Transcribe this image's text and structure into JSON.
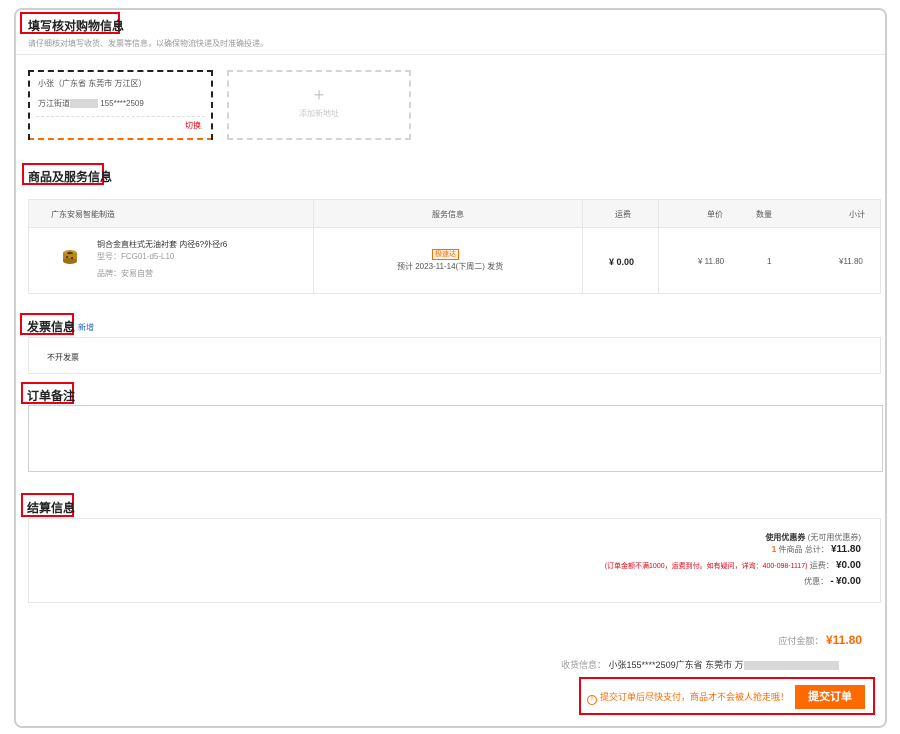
{
  "header": {
    "title": "填写核对购物信息",
    "hint": "请仔细核对填写收货、发票等信息，以确保物流快递及时准确投递。"
  },
  "address": {
    "selected": {
      "name": "小张（广东省 东莞市 万江区）",
      "street": "万江街道",
      "phone": "155****2509",
      "switch_label": "切换"
    },
    "add_label": "添加新地址",
    "add_icon": "plus-icon"
  },
  "goods": {
    "title": "商品及服务信息",
    "columns": {
      "shop": "广东安易智能制造",
      "service": "服务信息",
      "freight": "运费",
      "price": "单价",
      "qty": "数量",
      "subtotal": "小计"
    },
    "item": {
      "name": "铜合金直柱式无油衬套 内径6?外径r6",
      "model": "型号：FCG01-d5-L10",
      "brand": "品牌：安易自营",
      "tag": "极速达",
      "ship": "预计 2023-11-14(下周二) 发货",
      "freight": "¥ 0.00",
      "price": "¥ 11.80",
      "qty": "1",
      "subtotal": "¥11.80"
    }
  },
  "invoice": {
    "title": "发票信息",
    "add_link": "新增",
    "value": "不开发票"
  },
  "memo": {
    "title": "订单备注",
    "value": ""
  },
  "settlement": {
    "title": "结算信息",
    "coupon_label": "使用优惠券",
    "coupon_note": "(无可用优惠券)",
    "item_count": "1",
    "item_count_label": "件商品  总计：",
    "total": "¥11.80",
    "freight_note": "(订单金额不满1000，运费到付。如有疑问，详询：400-098-1117)",
    "freight_label": "运费：",
    "freight": "¥0.00",
    "discount_label": "优惠：",
    "discount_sign": "-",
    "discount": "¥0.00"
  },
  "footer": {
    "payable_label": "应付金额：",
    "payable": "¥11.80",
    "receiver_label": "收货信息：",
    "receiver": "小张155****2509广东省 东莞市 万",
    "warning": "提交订单后尽快支付，商品才不会被人抢走哦！",
    "warning_icon": "info-icon",
    "submit_label": "提交订单"
  },
  "colors": {
    "accent": "#ff6a00",
    "highlight": "#e60012",
    "link": "#1a66d6"
  }
}
